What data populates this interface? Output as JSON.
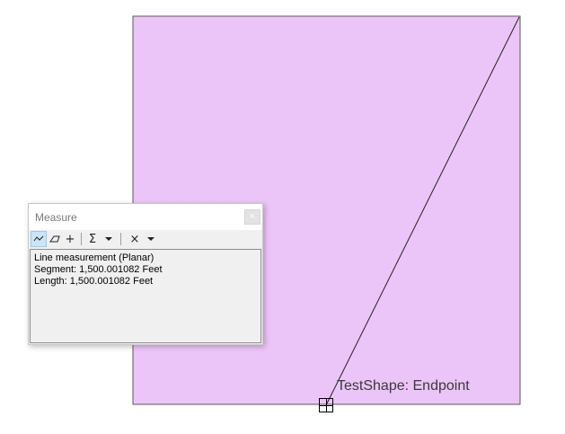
{
  "map": {
    "polygon_fill": "#ecc5f8",
    "polygon_stroke": "#5a5a5a",
    "measure_line_color": "#222222",
    "snap_tip": "TestShape: Endpoint"
  },
  "measure_window": {
    "title": "Measure",
    "close_label": "×",
    "toolbar": {
      "measure_line": "line-measure-icon",
      "measure_area": "area-measure-icon",
      "measure_feature": "plus-icon",
      "show_total": "Σ",
      "clear": "×"
    },
    "results": {
      "line1": "Line measurement (Planar)",
      "line2": "Segment: 1,500.001082 Feet",
      "line3": "Length: 1,500.001082 Feet"
    }
  }
}
